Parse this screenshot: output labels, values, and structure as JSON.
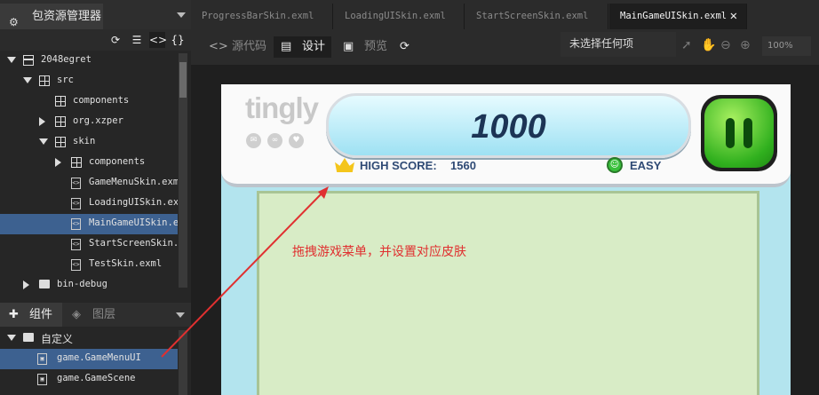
{
  "left_panel": {
    "title": "包资源管理器",
    "toolbar_icons": [
      "refresh-icon",
      "list-icon",
      "code-icon",
      "braces-icon"
    ],
    "tree": [
      {
        "label": "2048egret",
        "indent": 0,
        "arrow": "down",
        "icon": "proj"
      },
      {
        "label": "src",
        "indent": 1,
        "arrow": "down",
        "icon": "pkg"
      },
      {
        "label": "components",
        "indent": 2,
        "arrow": "",
        "icon": "pkg"
      },
      {
        "label": "org.xzper",
        "indent": 2,
        "arrow": "right",
        "icon": "pkg"
      },
      {
        "label": "skin",
        "indent": 2,
        "arrow": "down",
        "icon": "pkg"
      },
      {
        "label": "components",
        "indent": 3,
        "arrow": "right",
        "icon": "pkg"
      },
      {
        "label": "GameMenuSkin.exml",
        "indent": 3,
        "arrow": "",
        "icon": "file"
      },
      {
        "label": "LoadingUISkin.exml",
        "indent": 3,
        "arrow": "",
        "icon": "file"
      },
      {
        "label": "MainGameUISkin.exml",
        "indent": 3,
        "arrow": "",
        "icon": "file",
        "selected": true
      },
      {
        "label": "StartScreenSkin.exml",
        "indent": 3,
        "arrow": "",
        "icon": "file"
      },
      {
        "label": "TestSkin.exml",
        "indent": 3,
        "arrow": "",
        "icon": "file"
      },
      {
        "label": "bin-debug",
        "indent": 1,
        "arrow": "right",
        "icon": "folder"
      }
    ],
    "components_tab": "组件",
    "layers_tab": "图层",
    "components": [
      {
        "label": "自定义",
        "type": "folder"
      },
      {
        "label": "game.GameMenuUI",
        "type": "item",
        "selected": true
      },
      {
        "label": "game.GameScene",
        "type": "item"
      }
    ]
  },
  "tabs": [
    {
      "label": "ProgressBarSkin.exml",
      "active": false
    },
    {
      "label": "LoadingUISkin.exml",
      "active": false
    },
    {
      "label": "StartScreenSkin.exml",
      "active": false
    },
    {
      "label": "MainGameUISkin.exml",
      "active": true
    }
  ],
  "toolbar": {
    "source": "源代码",
    "design": "设计",
    "preview": "预览",
    "status": "未选择任何项",
    "zoom": "100%"
  },
  "game": {
    "logo": "tingly",
    "score": "1000",
    "high_score_label": "HIGH SCORE:",
    "high_score_value": "1560",
    "difficulty": "EASY",
    "annotation": "拖拽游戏菜单，并设置对应皮肤"
  },
  "colors": {
    "selection": "#3d6190",
    "annotation": "#e03030",
    "board": "#d8ecc6"
  }
}
